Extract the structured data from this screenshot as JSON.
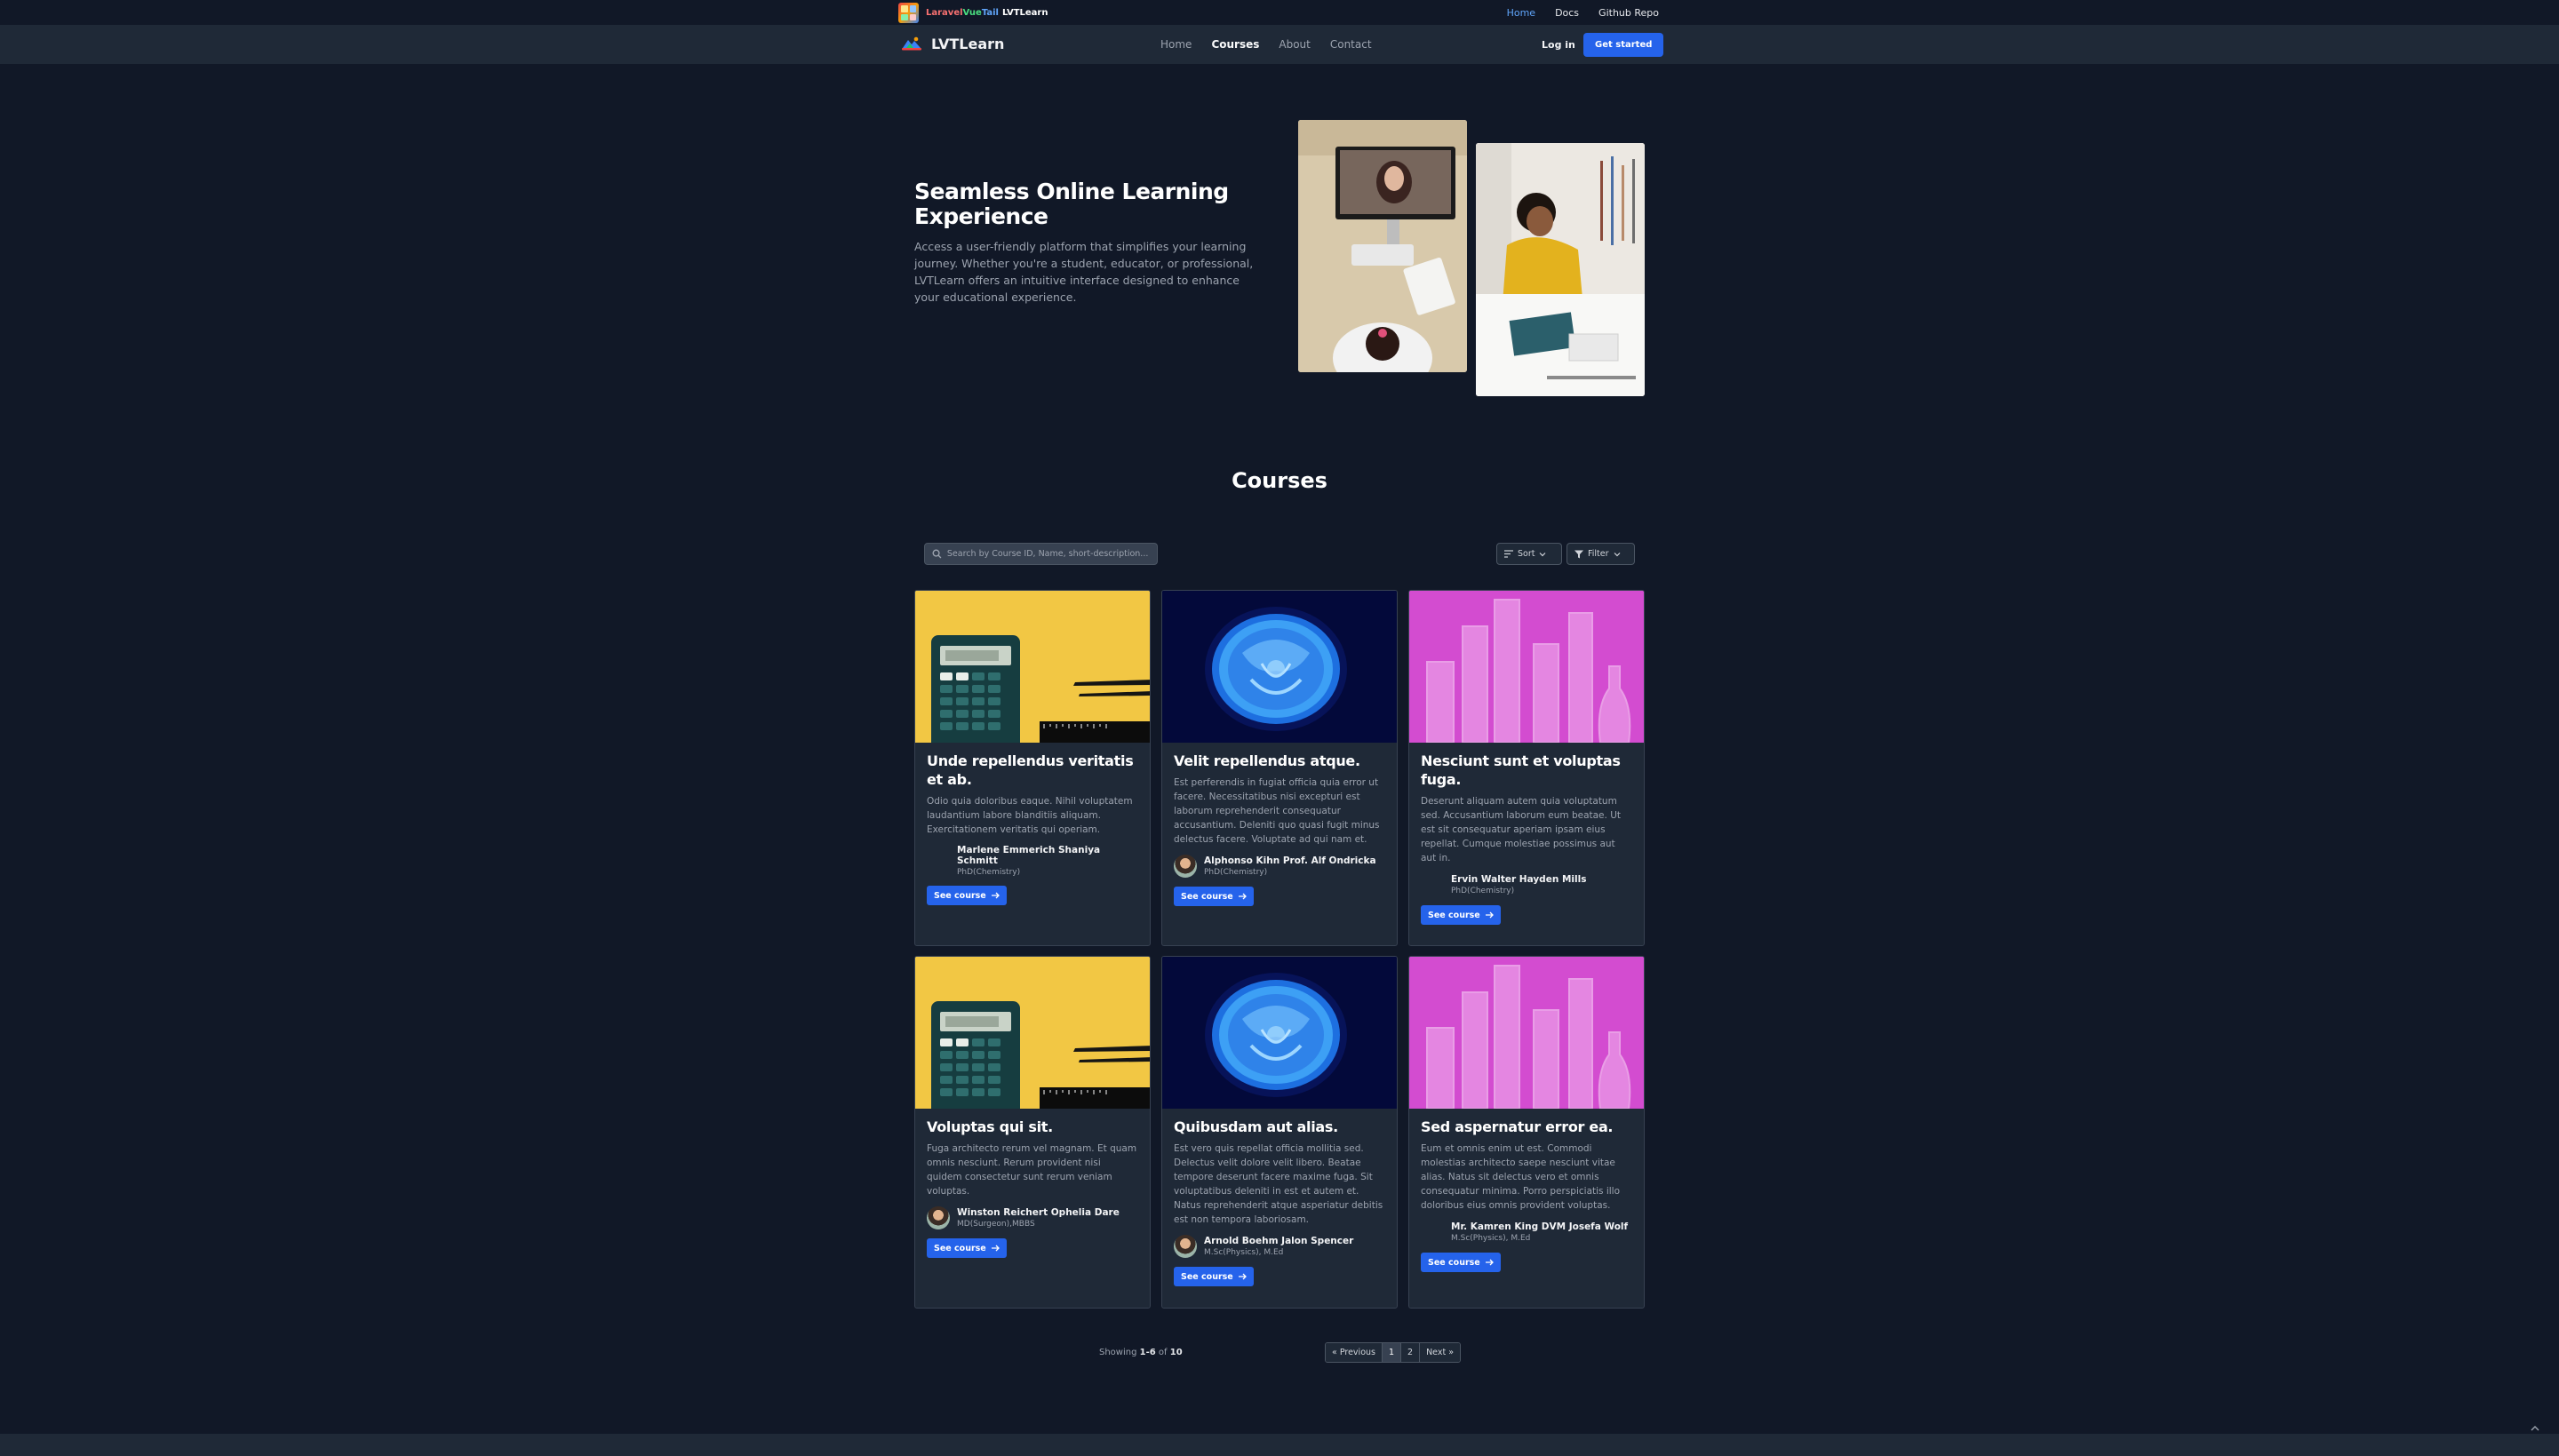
{
  "topbar": {
    "brand": {
      "part1": "Laravel",
      "part2": "Vue",
      "part3": "Tail",
      "suffix": "LVTLearn"
    },
    "links": [
      {
        "label": "Home",
        "active": true
      },
      {
        "label": "Docs",
        "active": false
      },
      {
        "label": "Github Repo",
        "active": false
      }
    ]
  },
  "nav": {
    "brand": "LVTLearn",
    "links": [
      {
        "label": "Home",
        "active": false
      },
      {
        "label": "Courses",
        "active": true
      },
      {
        "label": "About",
        "active": false
      },
      {
        "label": "Contact",
        "active": false
      }
    ],
    "login": "Log in",
    "get_started": "Get started"
  },
  "hero": {
    "title": "Seamless Online Learning Experience",
    "description": "Access a user-friendly platform that simplifies your learning journey. Whether you're a student, educator, or professional, LVTLearn offers an intuitive interface designed to enhance your educational experience."
  },
  "courses": {
    "title": "Courses",
    "search_placeholder": "Search by Course ID, Name, short-description...",
    "sort_label": "Sort",
    "filter_label": "Filter",
    "see_course_label": "See course",
    "items": [
      {
        "title": "Unde repellendus veritatis et ab.",
        "description": "Odio quia doloribus eaque. Nihil voluptatem laudantium labore blanditiis aliquam. Exercitationem veritatis qui operiam.",
        "instructor": "Marlene Emmerich Shaniya Schmitt",
        "degree": "PhD(Chemistry)",
        "image": "calculator",
        "avatar": "none"
      },
      {
        "title": "Velit repellendus atque.",
        "description": "Est perferendis in fugiat officia quia error ut facere. Necessitatibus nisi excepturi est laborum reprehenderit consequatur accusantium. Deleniti quo quasi fugit minus delectus facere. Voluptate ad qui nam et.",
        "instructor": "Alphonso Kihn Prof. Alf Ondricka",
        "degree": "PhD(Chemistry)",
        "image": "jellyfish",
        "avatar": "photo"
      },
      {
        "title": "Nesciunt sunt et voluptas fuga.",
        "description": "Deserunt aliquam autem quia voluptatum sed. Accusantium laborum eum beatae. Ut est sit consequatur aperiam ipsam eius repellat. Cumque molestiae possimus aut aut in.",
        "instructor": "Ervin Walter Hayden Mills",
        "degree": "PhD(Chemistry)",
        "image": "glassware",
        "avatar": "none"
      },
      {
        "title": "Voluptas qui sit.",
        "description": "Fuga architecto rerum vel magnam. Et quam omnis nesciunt. Rerum provident nisi quidem consectetur sunt rerum veniam voluptas.",
        "instructor": "Winston Reichert Ophelia Dare",
        "degree": "MD(Surgeon),MBBS",
        "image": "calculator",
        "avatar": "photo"
      },
      {
        "title": "Quibusdam aut alias.",
        "description": "Est vero quis repellat officia mollitia sed. Delectus velit dolore velit libero. Beatae tempore deserunt facere maxime fuga. Sit voluptatibus deleniti in est et autem et. Natus reprehenderit atque asperiatur debitis est non tempora laboriosam.",
        "instructor": "Arnold Boehm Jalon Spencer",
        "degree": "M.Sc(Physics), M.Ed",
        "image": "jellyfish",
        "avatar": "photo"
      },
      {
        "title": "Sed aspernatur error ea.",
        "description": "Eum et omnis enim ut est. Commodi molestias architecto saepe nesciunt vitae alias. Natus sit delectus vero et omnis consequatur minima. Porro perspiciatis illo doloribus eius omnis provident voluptas.",
        "instructor": "Mr. Kamren King DVM Josefa Wolf",
        "degree": "M.Sc(Physics), M.Ed",
        "image": "glassware",
        "avatar": "none"
      }
    ]
  },
  "pagination": {
    "showing_prefix": "Showing",
    "range": "1-6",
    "of_word": "of",
    "total": "10",
    "prev": "« Previous",
    "pages": [
      "1",
      "2"
    ],
    "current": "1",
    "next": "Next »"
  },
  "colors": {
    "background": "#111827",
    "surface": "#1f2937",
    "accent": "#2563eb",
    "active_link": "#60a5fa"
  }
}
